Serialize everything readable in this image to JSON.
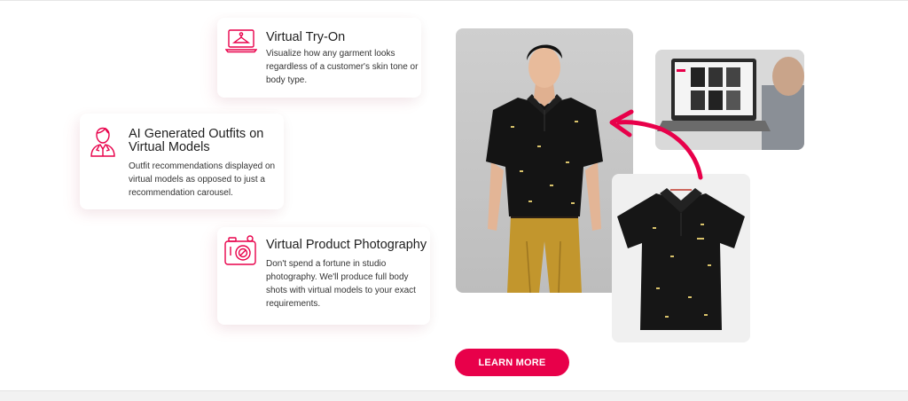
{
  "features": [
    {
      "id": "virtual-try-on",
      "icon": "hanger-laptop-icon",
      "title": "Virtual Try-On",
      "description": "Visualize how any garment looks regardless of a customer's skin tone or body type."
    },
    {
      "id": "ai-outfits",
      "icon": "virtual-model-icon",
      "title": "AI Generated Outfits on Virtual Models",
      "description": "Outfit recommendations displayed on virtual models as opposed to just a recommendation carousel."
    },
    {
      "id": "product-photography",
      "icon": "camera-icon",
      "title": "Virtual Product Photography",
      "description": "Don't spend a fortune in studio photography. We'll produce full body shots with virtual models to your exact requirements."
    }
  ],
  "images": {
    "model": "model-in-black-polo-photo",
    "laptop": "laptop-shop-screen-photo",
    "shirt": "black-polo-shirt-photo"
  },
  "cta": {
    "label": "LEARN MORE"
  },
  "colors": {
    "accent": "#e8004a",
    "accent_light": "#ef5a8a"
  }
}
